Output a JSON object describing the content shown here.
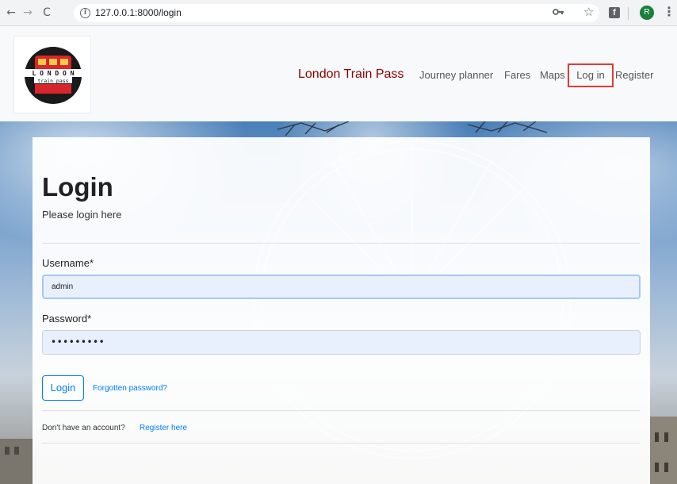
{
  "browser": {
    "back_glyph": "←",
    "forward_glyph": "→",
    "reload_glyph": "C",
    "url": "127.0.0.1:8000/login",
    "info_glyph": "i",
    "star_glyph": "☆",
    "ext_glyph": "f",
    "avatar_initial": "R",
    "menu_glyph": "⋮"
  },
  "header": {
    "logo_text_top": "L O N D O N",
    "logo_text_bottom": "train pass",
    "brand": "London Train Pass",
    "nav": {
      "journey_planner": "Journey planner",
      "fares": "Fares",
      "maps": "Maps",
      "login": "Log in",
      "register": "Register"
    }
  },
  "login": {
    "title": "Login",
    "subtitle": "Please login here",
    "username_label": "Username*",
    "username_value": "admin",
    "password_label": "Password*",
    "password_value": "•••••••••",
    "submit_label": "Login",
    "forgot_label": "Forgotten password?",
    "no_account_text": "Don't have an account?",
    "register_link": "Register here"
  },
  "colors": {
    "brand": "#8b0000",
    "link": "#007bff",
    "highlight": "#e53935",
    "autofill": "#e8f0fe"
  }
}
